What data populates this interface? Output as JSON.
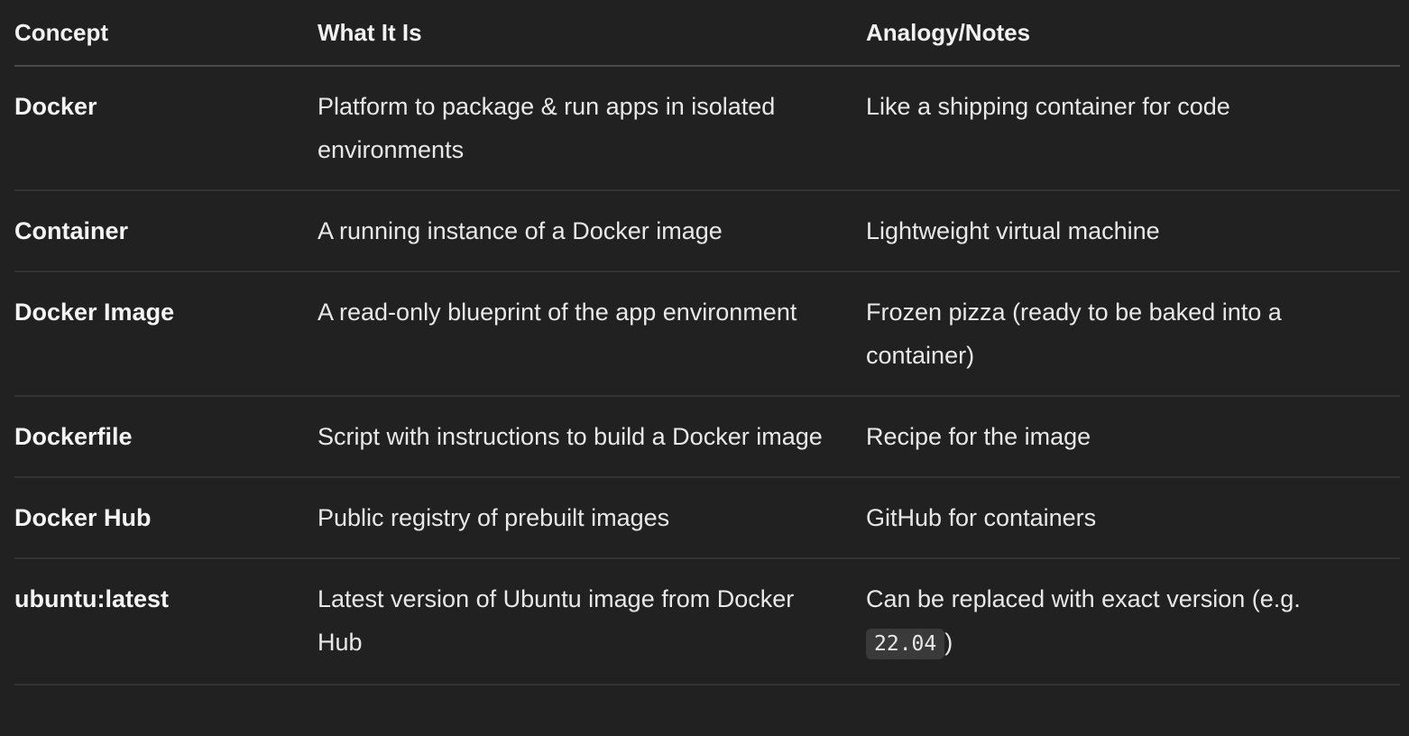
{
  "table": {
    "headers": [
      "Concept",
      "What It Is",
      "Analogy/Notes"
    ],
    "rows": [
      {
        "concept": "Docker",
        "what": "Platform to package & run apps in isolated environments",
        "notes": "Like a shipping container for code",
        "notes_code": "",
        "notes_suffix": ""
      },
      {
        "concept": "Container",
        "what": "A running instance of a Docker image",
        "notes": "Lightweight virtual machine",
        "notes_code": "",
        "notes_suffix": ""
      },
      {
        "concept": "Docker Image",
        "what": "A read-only blueprint of the app environment",
        "notes": "Frozen pizza (ready to be baked into a container)",
        "notes_code": "",
        "notes_suffix": ""
      },
      {
        "concept": "Dockerfile",
        "what": "Script with instructions to build a Docker image",
        "notes": "Recipe for the image",
        "notes_code": "",
        "notes_suffix": ""
      },
      {
        "concept": "Docker Hub",
        "what": "Public registry of prebuilt images",
        "notes": "GitHub for containers",
        "notes_code": "",
        "notes_suffix": ""
      },
      {
        "concept": "ubuntu:latest",
        "what": "Latest version of Ubuntu image from Docker Hub",
        "notes": "Can be replaced with exact version (e.g. ",
        "notes_code": "22.04",
        "notes_suffix": ")"
      }
    ]
  }
}
